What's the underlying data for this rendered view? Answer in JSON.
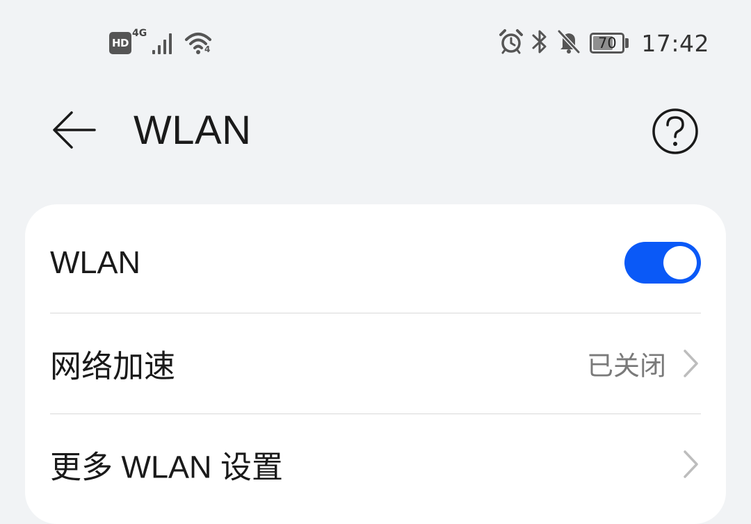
{
  "status_bar": {
    "hd_label": "HD",
    "network_type": "4G",
    "wifi_badge": "4",
    "battery_level": "70",
    "battery_fraction": 0.7,
    "time": "17:42",
    "icons": [
      "hd-icon",
      "cellular-signal-icon",
      "wifi-icon",
      "alarm-clock-icon",
      "bluetooth-icon",
      "notifications-muted-icon",
      "battery-icon"
    ]
  },
  "header": {
    "title": "WLAN",
    "back_icon": "arrow-left-icon",
    "help_icon": "question-mark-circle-icon"
  },
  "settings": {
    "wlan_toggle": {
      "label": "WLAN",
      "enabled": true,
      "accent_color": "#0a59f7"
    },
    "network_acceleration": {
      "label": "网络加速",
      "value": "已关闭"
    },
    "more_settings": {
      "label": "更多 WLAN 设置"
    }
  }
}
